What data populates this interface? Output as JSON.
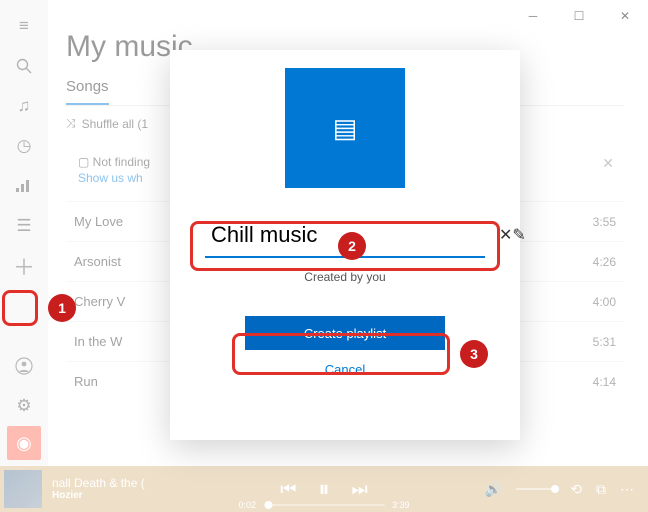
{
  "page_title": "My music",
  "tabs": {
    "songs": "Songs"
  },
  "shuffle_label": "Shuffle all (1",
  "notice": {
    "title": "Not finding",
    "link": "Show us wh"
  },
  "songs": [
    {
      "title": "My Love",
      "duration": "3:55"
    },
    {
      "title": "Arsonist",
      "duration": "4:26"
    },
    {
      "title": "Cherry V",
      "duration": "4:00"
    },
    {
      "title": "In the W",
      "duration": "5:31"
    },
    {
      "title": "Run",
      "duration": "4:14"
    }
  ],
  "dialog": {
    "name_value": "Chill music",
    "subtitle": "Created by you",
    "create_label": "Create playlist",
    "cancel_label": "Cancel"
  },
  "footer": {
    "track": "nall Death & the (",
    "artist": "Hozier",
    "elapsed": "0:02",
    "total": "3:39"
  },
  "callouts": {
    "b1": "1",
    "b2": "2",
    "b3": "3"
  }
}
